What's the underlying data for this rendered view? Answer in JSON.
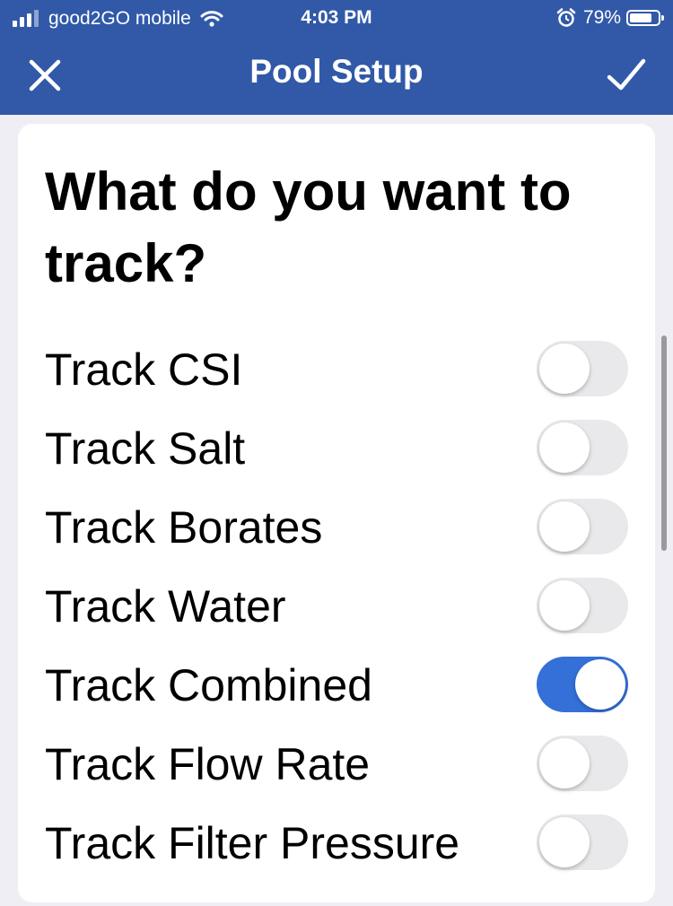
{
  "status_bar": {
    "carrier": "good2GO mobile",
    "time": "4:03 PM",
    "battery": "79%",
    "battery_level": 0.79,
    "signal_bars": 3,
    "icons": [
      "signal-icon",
      "wifi-icon",
      "alarm-icon",
      "battery-icon"
    ]
  },
  "nav": {
    "title": "Pool Setup",
    "close_icon": "close-icon",
    "done_icon": "checkmark-icon"
  },
  "card": {
    "question": "What do you want to track?",
    "options": [
      {
        "label": "Track CSI",
        "on": false
      },
      {
        "label": "Track Salt",
        "on": false
      },
      {
        "label": "Track Borates",
        "on": false
      },
      {
        "label": "Track Water",
        "on": false
      },
      {
        "label": "Track Combined",
        "on": true
      },
      {
        "label": "Track Flow Rate",
        "on": false
      },
      {
        "label": "Track Filter Pressure",
        "on": false
      }
    ]
  },
  "colors": {
    "header": "#3159a8",
    "toggle_on": "#3470d8",
    "toggle_off": "#e9e9eb",
    "background": "#eeeef4"
  }
}
